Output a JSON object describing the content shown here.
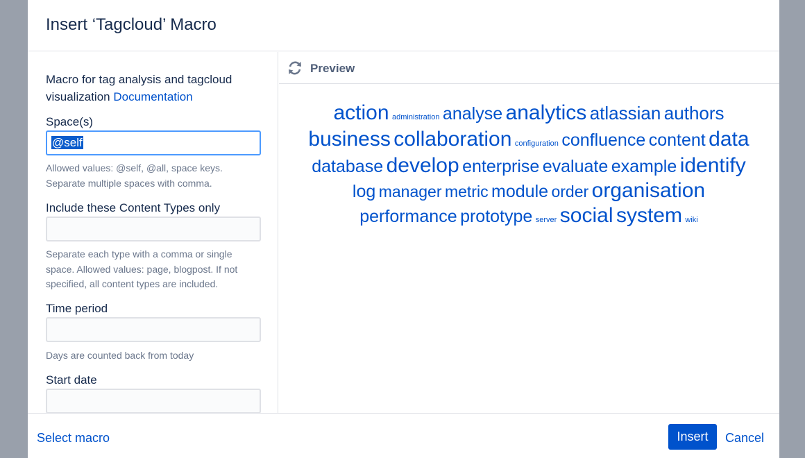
{
  "dialog": {
    "title": "Insert ‘Tagcloud’ Macro"
  },
  "left": {
    "description": "Macro for tag analysis and tagcloud visualization",
    "doc_link": "Documentation",
    "fields": [
      {
        "label": "Space(s)",
        "value": "@self",
        "help": "Allowed values: @self, @all, space keys. Separate multiple spaces with comma."
      },
      {
        "label": "Include these Content Types only",
        "value": "",
        "help": "Separate each type with a comma or single space. Allowed values: page, blogpost. If not specified, all content types are included."
      },
      {
        "label": "Time period",
        "value": "",
        "help": "Days are counted back from today"
      },
      {
        "label": "Start date",
        "value": ""
      }
    ]
  },
  "preview": {
    "label": "Preview",
    "icon": "refresh-icon",
    "tags": [
      {
        "text": "action",
        "size": 30
      },
      {
        "text": "administration",
        "size": 11
      },
      {
        "text": "analyse",
        "size": 25
      },
      {
        "text": "analytics",
        "size": 30
      },
      {
        "text": "atlassian",
        "size": 26
      },
      {
        "text": "authors",
        "size": 26
      },
      {
        "text": "business",
        "size": 30
      },
      {
        "text": "collaboration",
        "size": 30
      },
      {
        "text": "configuration",
        "size": 11
      },
      {
        "text": "confluence",
        "size": 25
      },
      {
        "text": "content",
        "size": 25
      },
      {
        "text": "data",
        "size": 30
      },
      {
        "text": "database",
        "size": 25
      },
      {
        "text": "develop",
        "size": 30
      },
      {
        "text": "enterprise",
        "size": 25
      },
      {
        "text": "evaluate",
        "size": 25
      },
      {
        "text": "example",
        "size": 25
      },
      {
        "text": "identify",
        "size": 30
      },
      {
        "text": "log",
        "size": 25
      },
      {
        "text": "manager",
        "size": 23
      },
      {
        "text": "metric",
        "size": 23
      },
      {
        "text": "module",
        "size": 25
      },
      {
        "text": "order",
        "size": 23
      },
      {
        "text": "organisation",
        "size": 30
      },
      {
        "text": "performance",
        "size": 25
      },
      {
        "text": "prototype",
        "size": 25
      },
      {
        "text": "server",
        "size": 11
      },
      {
        "text": "social",
        "size": 30
      },
      {
        "text": "system",
        "size": 30
      },
      {
        "text": "wiki",
        "size": 11
      }
    ]
  },
  "footer": {
    "select_macro": "Select macro",
    "insert": "Insert",
    "cancel": "Cancel"
  },
  "colors": {
    "link": "#0052cc",
    "primary_button": "#0052cc",
    "backdrop": "#99a0ab"
  }
}
